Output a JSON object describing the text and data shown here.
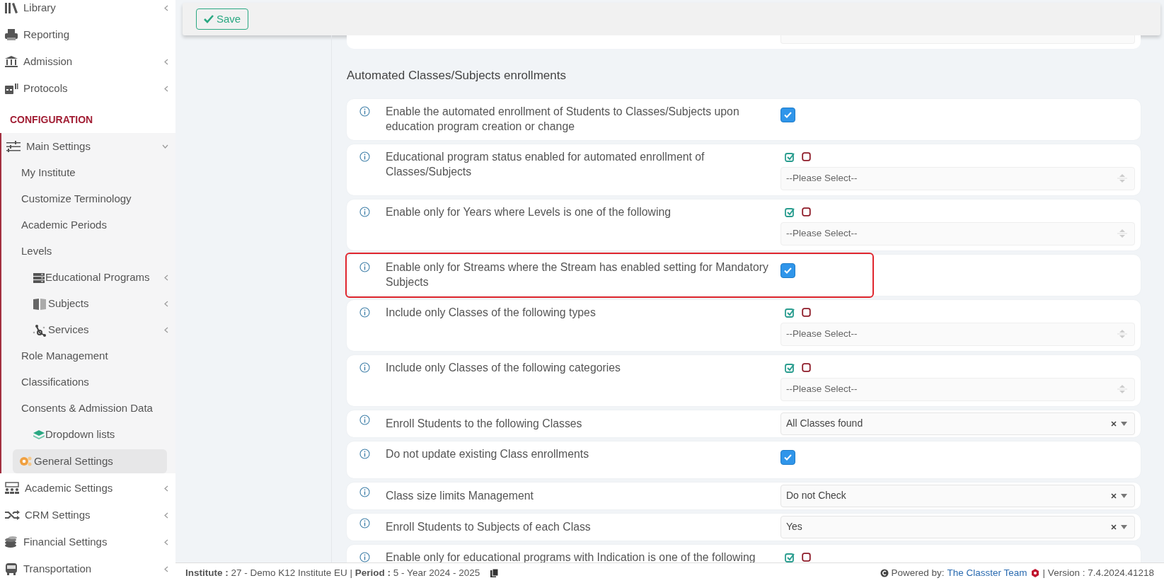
{
  "sidebar": {
    "items": [
      {
        "kind": "item",
        "label": "Library",
        "has_submenu": true
      },
      {
        "kind": "item",
        "label": "Reporting",
        "has_submenu": false
      },
      {
        "kind": "item",
        "label": "Admission",
        "has_submenu": true
      },
      {
        "kind": "item",
        "label": "Protocols",
        "has_submenu": true
      },
      {
        "kind": "header",
        "label": "CONFIGURATION"
      },
      {
        "kind": "item",
        "label": "Main Settings",
        "has_submenu": true,
        "expanded": true,
        "children": [
          {
            "label": "My Institute",
            "has_submenu": false,
            "selected": false
          },
          {
            "label": "Customize Terminology",
            "has_submenu": false,
            "selected": false
          },
          {
            "label": "Academic Periods",
            "has_submenu": false,
            "selected": false
          },
          {
            "label": "Levels",
            "has_submenu": false,
            "selected": false
          },
          {
            "label": "Educational Programs",
            "has_submenu": true,
            "selected": false
          },
          {
            "label": "Subjects",
            "has_submenu": true,
            "selected": false
          },
          {
            "label": "Services",
            "has_submenu": true,
            "selected": false
          },
          {
            "label": "Role Management",
            "has_submenu": false,
            "selected": false
          },
          {
            "label": "Classifications",
            "has_submenu": false,
            "selected": false
          },
          {
            "label": "Consents & Admission Data",
            "has_submenu": false,
            "selected": false
          },
          {
            "label": "Dropdown lists",
            "has_submenu": false,
            "selected": false
          },
          {
            "label": "General Settings",
            "has_submenu": false,
            "selected": true
          }
        ]
      },
      {
        "kind": "item",
        "label": "Academic Settings",
        "has_submenu": true,
        "expanded": false
      },
      {
        "kind": "item",
        "label": "CRM Settings",
        "has_submenu": true,
        "expanded": false
      },
      {
        "kind": "item",
        "label": "Financial Settings",
        "has_submenu": true,
        "expanded": false
      },
      {
        "kind": "item",
        "label": "Transportation",
        "has_submenu": true,
        "expanded": false
      }
    ]
  },
  "toolbar": {
    "save_button": "Save"
  },
  "section_title": "Automated Classes/Subjects enrollments",
  "settings": [
    {
      "kind": "checkbox",
      "label": "Enable the automated enrollment of Students to Classes/Subjects upon education program creation or change",
      "checked": true,
      "highlighted": false
    },
    {
      "kind": "multi",
      "label": "Educational program status enabled for automated enrollment of Classes/Subjects",
      "placeholder": "--Please Select--",
      "highlighted": false
    },
    {
      "kind": "multi",
      "label": "Enable only for Years where Levels is one of the following",
      "placeholder": "--Please Select--",
      "highlighted": false
    },
    {
      "kind": "checkbox",
      "label": "Enable only for Streams where the Stream has enabled setting for Mandatory Subjects",
      "checked": true,
      "highlighted": true
    },
    {
      "kind": "multi",
      "label": "Include only Classes of the following types",
      "placeholder": "--Please Select--",
      "highlighted": false
    },
    {
      "kind": "multi",
      "label": "Include only Classes of the following categories",
      "placeholder": "--Please Select--",
      "highlighted": false
    },
    {
      "kind": "select",
      "label": "Enroll Students to the following Classes",
      "value": "All Classes found",
      "highlighted": false
    },
    {
      "kind": "checkbox",
      "label": "Do not update existing Class enrollments",
      "checked": true,
      "highlighted": false
    },
    {
      "kind": "select",
      "label": "Class size limits Management",
      "value": "Do not Check",
      "highlighted": false
    },
    {
      "kind": "select",
      "label": "Enroll Students to Subjects of each Class",
      "value": "Yes",
      "highlighted": false
    },
    {
      "kind": "multi",
      "label": "Enable only for educational programs with Indication is one of the following",
      "highlighted": false
    }
  ],
  "footer": {
    "context": "**Institute :** 27 - Demo K12 Institute EU | **Period :** 5 - Year 2024 - 2025",
    "powered_by": "Powered by:",
    "team_link": "The Classter Team",
    "version": "| Version : 7.4.2024.41218"
  }
}
